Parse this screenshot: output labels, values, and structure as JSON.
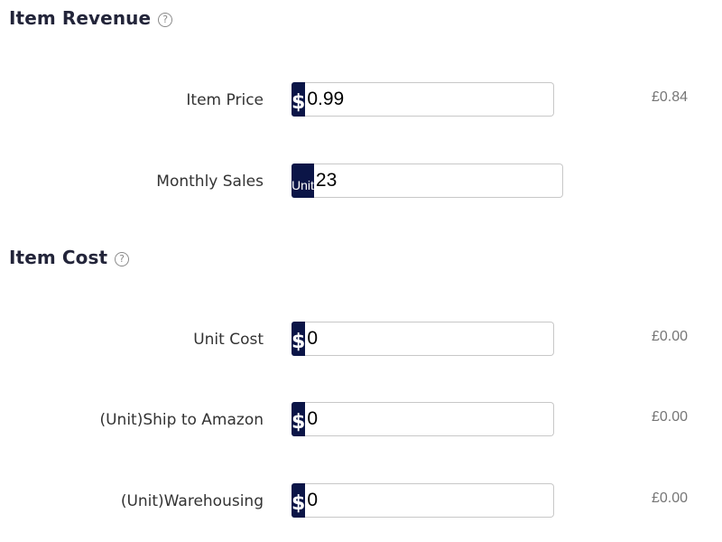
{
  "revenue": {
    "title": "Item Revenue",
    "help_icon": "question-circle-icon",
    "rows": [
      {
        "label": "Item Price",
        "addon": "$",
        "value": "0.99",
        "result": "£0.84"
      },
      {
        "label": "Monthly Sales",
        "addon": "Unit",
        "value": "23",
        "result": ""
      }
    ]
  },
  "cost": {
    "title": "Item Cost",
    "help_icon": "question-circle-icon",
    "rows": [
      {
        "label": "Unit Cost",
        "addon": "$",
        "value": "0",
        "result": "£0.00"
      },
      {
        "label": "(Unit)Ship to Amazon",
        "addon": "$",
        "value": "0",
        "result": "£0.00"
      },
      {
        "label": "(Unit)Warehousing",
        "addon": "$",
        "value": "0",
        "result": "£0.00"
      }
    ]
  },
  "colors": {
    "addon_bg": "#0b1547",
    "title": "#23253a",
    "result": "#767676"
  },
  "help_glyph": "?"
}
